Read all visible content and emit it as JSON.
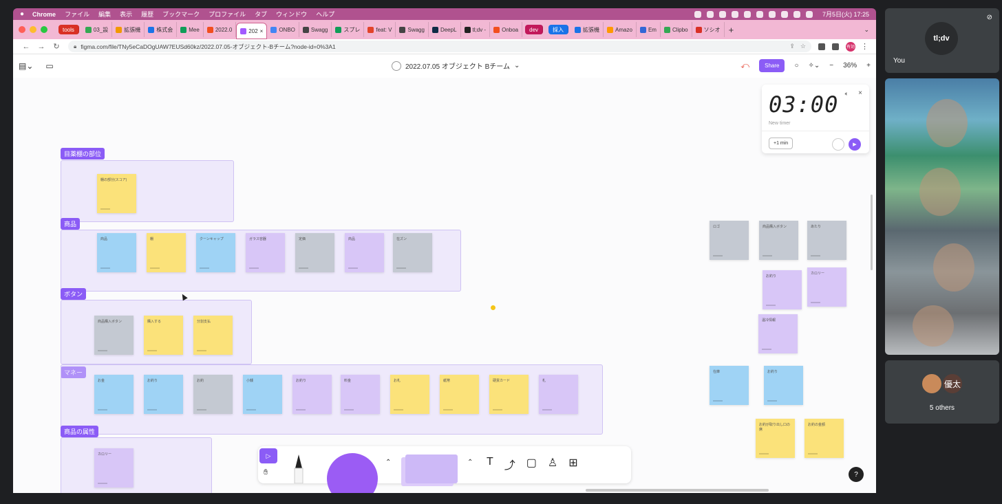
{
  "menubar": {
    "app": "Chrome",
    "items": [
      "ファイル",
      "編集",
      "表示",
      "履歴",
      "ブックマーク",
      "プロファイル",
      "タブ",
      "ウィンドウ",
      "ヘルプ"
    ],
    "clock": "7月5日(火) 17:25"
  },
  "tabs": {
    "group_tools": "tools",
    "items": [
      "03_設",
      "拡張機",
      "株式会",
      "Mee",
      "2022.0",
      "202",
      "ONBO",
      "Swagg",
      "スプレ",
      "feat: V",
      "Swagg",
      "DeepL",
      "tl;dv -",
      "Onboa"
    ],
    "active_index": 5,
    "group_dev": "dev",
    "group_hire": "採入",
    "items2": [
      "拡張機",
      "Amazo",
      "Em",
      "Clipbo",
      "ソシオ"
    ]
  },
  "address": {
    "url": "figma.com/file/TNy5eCaDOgUAW7EUSd60kz/2022.07.05-オブジェクト-Bチーム?node-id=0%3A1",
    "profile": "有効"
  },
  "figma": {
    "file_title": "2022.07.05 オブジェクト Bチーム",
    "share_label": "Share",
    "zoom": "36%"
  },
  "timer": {
    "time": "03:00",
    "label": "New timer",
    "add_label": "+1 min"
  },
  "sections": [
    {
      "label": "目薬棚の部位"
    },
    {
      "label": "商品"
    },
    {
      "label": "ボタン"
    },
    {
      "label": "マネー"
    },
    {
      "label": "商品の属性"
    }
  ],
  "stickies": {
    "s0": "棚の部分(スコア)",
    "s1": "商品",
    "s2": "棚",
    "s3": "クーンキャップ",
    "s4": "ガラス容器",
    "s5": "定価",
    "s6": "商品",
    "s7": "在ズン",
    "s8": "商品購入ボタン",
    "s9": "購入する",
    "s10": "分割支払",
    "s11": "お金",
    "s12": "お釣り",
    "s13": "お釣",
    "s14": "小銭",
    "s15": "お釣り",
    "s16": "料金",
    "s17": "お札",
    "s18": "紙幣",
    "s19": "硬貨カード",
    "s20": "札",
    "s21": "カロリー",
    "r1": "ロゴ",
    "r2": "商品購入ボタン",
    "r3": "あたり",
    "r4": "お釣り",
    "r5": "カロリー",
    "r6": "温冷情報",
    "r7": "在庫",
    "r8": "お釣り",
    "r9": "お釣が取り出し口の席",
    "r10": "お釣の金額"
  },
  "meet": {
    "you_label": "You",
    "brand": "tl;dv",
    "avatar_initials": "優太",
    "others_label": "5 others"
  },
  "colors": {
    "accent": "#8b5cf6",
    "menubar": "#b0528f",
    "tabstrip": "#f2b8d4",
    "sticky_yellow": "#fbe27a",
    "sticky_blue": "#9fd3f5",
    "sticky_purple": "#d8c6f7",
    "sticky_gray": "#c4c9d2"
  }
}
